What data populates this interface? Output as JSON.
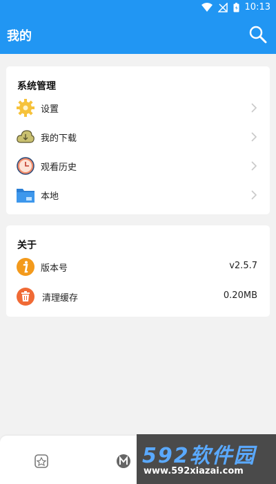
{
  "status_bar": {
    "time": "10:13"
  },
  "app_bar": {
    "title": "我的"
  },
  "sections": {
    "system": {
      "title": "系统管理",
      "items": [
        {
          "label": "设置",
          "icon": "gear-icon"
        },
        {
          "label": "我的下载",
          "icon": "download-cloud-icon"
        },
        {
          "label": "观看历史",
          "icon": "clock-icon"
        },
        {
          "label": "本地",
          "icon": "folder-icon"
        }
      ]
    },
    "about": {
      "title": "关于",
      "items": [
        {
          "label": "版本号",
          "value": "v2.5.7",
          "icon": "info-icon"
        },
        {
          "label": "清理缓存",
          "value": "0.20MB",
          "icon": "trash-icon"
        }
      ]
    }
  },
  "watermark": {
    "big": "592软件园",
    "small": "www.592xiazai.com"
  },
  "colors": {
    "primary": "#2196f3",
    "gear": "#f6c23b",
    "cloud": "#c9c070",
    "clock": "#f08b6a",
    "folder": "#2a7fd6",
    "info": "#f39a1c",
    "trash": "#f06a35"
  }
}
